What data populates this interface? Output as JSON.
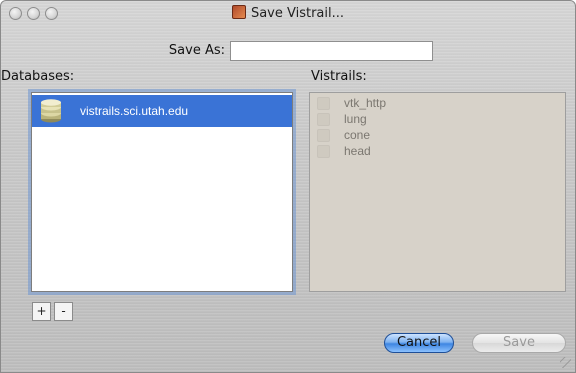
{
  "window": {
    "title": "Save Vistrail..."
  },
  "form": {
    "save_as_label": "Save As:",
    "save_as_value": ""
  },
  "databases": {
    "label": "Databases:",
    "items": [
      {
        "label": "vistrails.sci.utah.edu",
        "selected": true
      }
    ],
    "add_label": "+",
    "remove_label": "-"
  },
  "vistrails": {
    "label": "Vistrails:",
    "items": [
      {
        "label": "vtk_http",
        "checked": false
      },
      {
        "label": "lung",
        "checked": false
      },
      {
        "label": "cone",
        "checked": false
      },
      {
        "label": "head",
        "checked": false
      }
    ]
  },
  "buttons": {
    "cancel_label": "Cancel",
    "save_label": "Save"
  },
  "colors": {
    "selection": "#3a73d6",
    "default_button": "#3e86e2"
  },
  "icons": {
    "title": "vistrails-app-icon",
    "database": "database-icon"
  }
}
